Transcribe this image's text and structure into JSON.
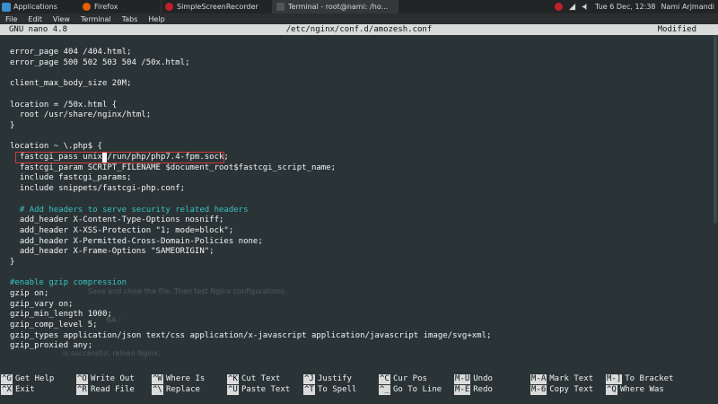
{
  "panel": {
    "applications": "Applications",
    "tasks": [
      {
        "label": "Firefox",
        "color": "#e66000"
      },
      {
        "label": "SimpleScreenRecorder",
        "color": "#c0202a"
      },
      {
        "label": "Terminal - root@nami: /ho...",
        "color": "#555555"
      }
    ],
    "datetime": "Tue 6 Dec, 12:38",
    "user": "Nami Arjmandi"
  },
  "menubar": [
    "File",
    "Edit",
    "View",
    "Terminal",
    "Tabs",
    "Help"
  ],
  "nano": {
    "version": "GNU nano 4.8",
    "filename": "/etc/nginx/conf.d/amozesh.conf",
    "status": "Modified"
  },
  "lines": [
    "error_page 404 /404.html;",
    "error_page 500 502 503 504 /50x.html;",
    "",
    "client_max_body_size 20M;",
    "",
    "location = /50x.html {",
    "  root /usr/share/nginx/html;",
    "}",
    "",
    "location ~ \\.php$ {",
    "  fastcgi_pass unix:/run/php/php7.4-fpm.sock;",
    "  fastcgi_param SCRIPT_FILENAME $document_root$fastcgi_script_name;",
    "  include fastcgi_params;",
    "  include snippets/fastcgi-php.conf;",
    "",
    "  # Add headers to serve security related headers",
    "  add_header X-Content-Type-Options nosniff;",
    "  add_header X-XSS-Protection \"1; mode=block\";",
    "  add_header X-Permitted-Cross-Domain-Policies none;",
    "  add_header X-Frame-Options \"SAMEORIGIN\";",
    "}",
    "",
    "#enable gzip compression",
    "gzip on;",
    "gzip_vary on;",
    "gzip_min_length 1000;",
    "gzip_comp_level 5;",
    "gzip_types application/json text/css application/x-javascript application/javascript image/svg+xml;",
    "gzip_proxied any;"
  ],
  "ghost_texts": {
    "a": "Save and close the file. Then test Nginx configurations.",
    "b": "NA  :",
    "c": "is successful, reload Nginx."
  },
  "shortcuts": [
    {
      "key": "^G",
      "label": "Get Help"
    },
    {
      "key": "^O",
      "label": "Write Out"
    },
    {
      "key": "^W",
      "label": "Where Is"
    },
    {
      "key": "^K",
      "label": "Cut Text"
    },
    {
      "key": "^J",
      "label": "Justify"
    },
    {
      "key": "^C",
      "label": "Cur Pos"
    },
    {
      "key": "M-U",
      "label": "Undo"
    },
    {
      "key": "M-A",
      "label": "Mark Text"
    },
    {
      "key": "M-]",
      "label": "To Bracket"
    },
    {
      "key": "^X",
      "label": "Exit"
    },
    {
      "key": "^R",
      "label": "Read File"
    },
    {
      "key": "^\\",
      "label": "Replace"
    },
    {
      "key": "^U",
      "label": "Paste Text"
    },
    {
      "key": "^T",
      "label": "To Spell"
    },
    {
      "key": "^_",
      "label": "Go To Line"
    },
    {
      "key": "M-E",
      "label": "Redo"
    },
    {
      "key": "M-6",
      "label": "Copy Text"
    },
    {
      "key": "^Q",
      "label": "Where Was"
    }
  ],
  "colors": {
    "background": "#2a3436",
    "comment": "#39c1c1",
    "highlight": "#d23a3a",
    "titlebar": "#d9dbdb"
  }
}
